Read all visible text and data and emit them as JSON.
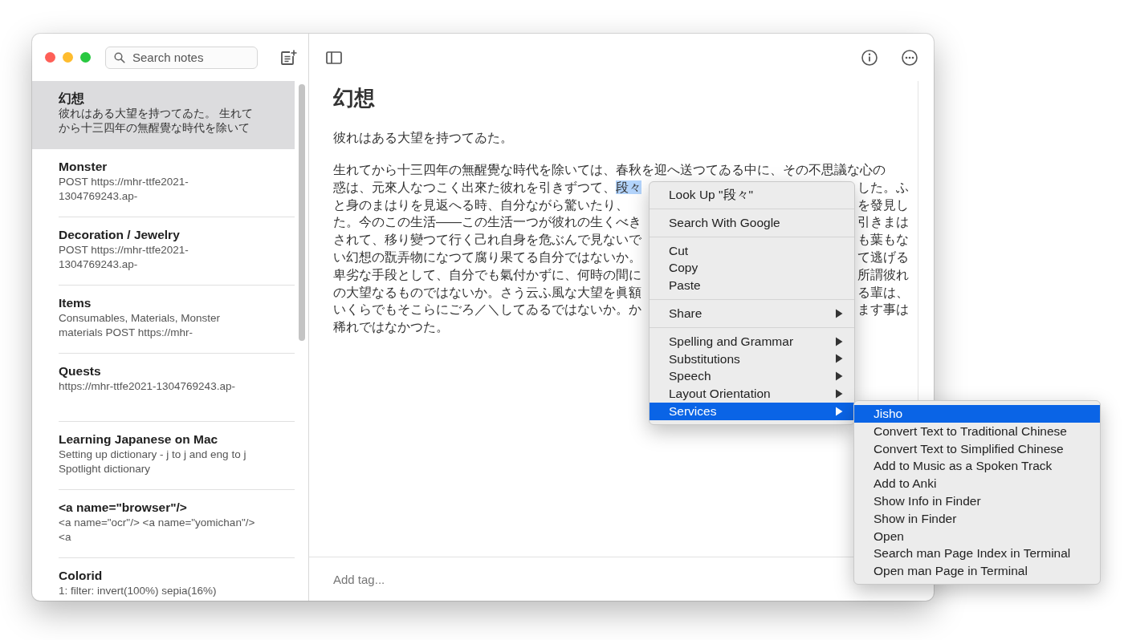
{
  "search": {
    "placeholder": "Search notes"
  },
  "notes": [
    {
      "title": "幻想",
      "preview": "彼れはある大望を持つてゐた。 生れてから十三四年の無醒覺な時代を除いて",
      "selected": true
    },
    {
      "title": "Monster",
      "preview": "POST https://mhr-ttfe2021-1304769243.ap-",
      "selected": false
    },
    {
      "title": "Decoration / Jewelry",
      "preview": "POST https://mhr-ttfe2021-1304769243.ap-",
      "selected": false
    },
    {
      "title": "Items",
      "preview": "Consumables, Materials, Monster materials POST https://mhr-",
      "selected": false
    },
    {
      "title": "Quests",
      "preview": "https://mhr-ttfe2021-1304769243.ap-",
      "selected": false
    },
    {
      "title": "Learning Japanese on Mac",
      "preview": "Setting up dictionary - j to j and eng to j Spotlight dictionary",
      "selected": false
    },
    {
      "title": "<a name=\"browser\"/>",
      "preview": "<a name=\"ocr\"/> <a name=\"yomichan\"/> <a",
      "selected": false
    },
    {
      "title": "Colorid",
      "preview": "1: filter: invert(100%) sepia(16%)",
      "selected": false
    }
  ],
  "note": {
    "title": "幻想",
    "intro": "彼れはある大望を持つてゐた。",
    "lines": [
      {
        "left": "生れてから十三四年の無醒覺な時代を除いては、春秋を迎へ送つてゐる中に、その不思議な心の"
      },
      {
        "left": "惑は、元來人なつこく出來た彼れを引きずつて、",
        "selection": "段々",
        "right": "した。ふ"
      },
      {
        "left": "と身のまはりを見返へる時、自分ながら驚いたり、",
        "right": "を發見し"
      },
      {
        "left": "た。今のこの生活——この生活一つが彼れの生くべき",
        "right": "引きまは"
      },
      {
        "left": "されて、移り變つて行く己れ自身を危ぶんで見ないで",
        "right": "も葉もな"
      },
      {
        "left": "い幻想の翫弄物になつて腐り果てる自分ではないか。",
        "right": "て逃げる"
      },
      {
        "left": "卑劣な手段として、自分でも氣付かずに、何時の間に",
        "right": "所謂彼れ"
      },
      {
        "left": "の大望なるものではないか。さう云ふ風な大望を眞額",
        "right": "る輩は、"
      },
      {
        "left": "いくらでもそこらにごろ／＼してゐるではないか。か",
        "right": "ます事は"
      },
      {
        "left": "稀れではなかつた。"
      }
    ]
  },
  "tag_field": {
    "placeholder": "Add tag..."
  },
  "context_menu": [
    [
      {
        "label": "Look Up \"段々\"",
        "submenu": false,
        "selected": false
      }
    ],
    [
      {
        "label": "Search With Google",
        "submenu": false,
        "selected": false
      }
    ],
    [
      {
        "label": "Cut",
        "submenu": false,
        "selected": false
      },
      {
        "label": "Copy",
        "submenu": false,
        "selected": false
      },
      {
        "label": "Paste",
        "submenu": false,
        "selected": false
      }
    ],
    [
      {
        "label": "Share",
        "submenu": true,
        "selected": false
      }
    ],
    [
      {
        "label": "Spelling and Grammar",
        "submenu": true,
        "selected": false
      },
      {
        "label": "Substitutions",
        "submenu": true,
        "selected": false
      },
      {
        "label": "Speech",
        "submenu": true,
        "selected": false
      },
      {
        "label": "Layout Orientation",
        "submenu": true,
        "selected": false
      },
      {
        "label": "Services",
        "submenu": true,
        "selected": true
      }
    ]
  ],
  "services_menu": [
    {
      "label": "Jisho",
      "selected": true
    },
    {
      "label": "Convert Text to Traditional Chinese",
      "selected": false
    },
    {
      "label": "Convert Text to Simplified Chinese",
      "selected": false
    },
    {
      "label": "Add to Music as a Spoken Track",
      "selected": false
    },
    {
      "label": "Add to Anki",
      "selected": false
    },
    {
      "label": "Show Info in Finder",
      "selected": false
    },
    {
      "label": "Show in Finder",
      "selected": false
    },
    {
      "label": "Open",
      "selected": false
    },
    {
      "label": "Search man Page Index in Terminal",
      "selected": false
    },
    {
      "label": "Open man Page in Terminal",
      "selected": false
    }
  ]
}
